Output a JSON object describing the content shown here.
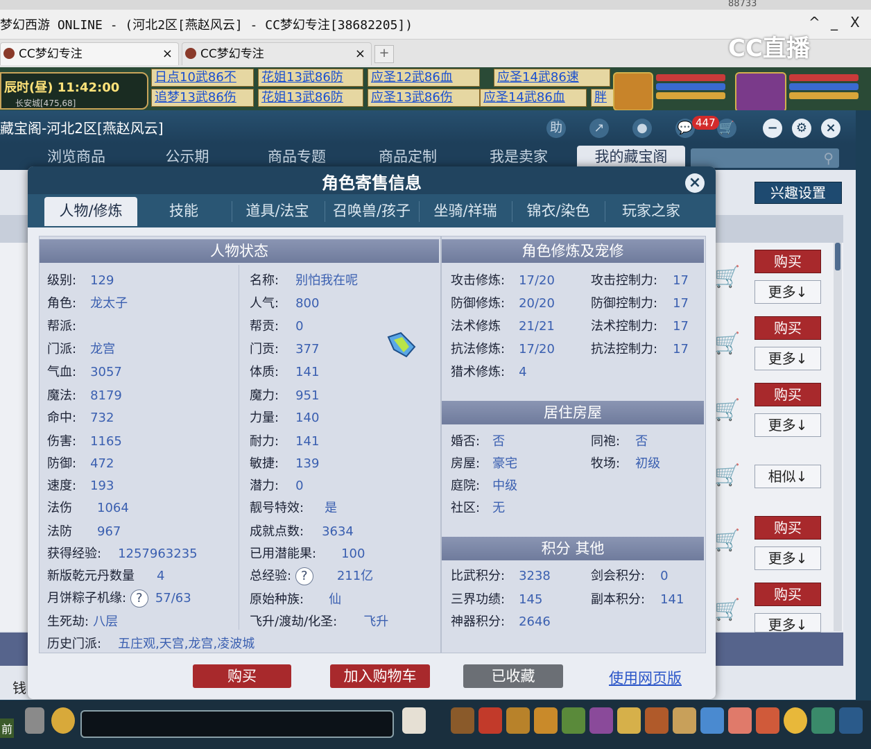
{
  "window": {
    "top_partial": "88733",
    "title": "梦幻西游 ONLINE - (河北2区[燕赵风云] - CC梦幻专注[38682205])",
    "controls": [
      "^",
      "_",
      "X"
    ]
  },
  "browser_tabs": [
    {
      "label": "CC梦幻专注",
      "close": "×"
    },
    {
      "label": "CC梦幻专注",
      "close": "×"
    }
  ],
  "new_tab": "+",
  "stream_logo": "CC直播",
  "game": {
    "time": "辰时(昼) 11:42:00",
    "location": "长安城[475,68]",
    "ads_row1": [
      "日点10武86不",
      "花姐13武86防",
      "应圣12武86血",
      "应圣14武86速"
    ],
    "ads_row2": [
      "追梦13武86伤",
      "花姐13武86防",
      "应圣13武86伤",
      "应圣14武86血",
      "胖"
    ]
  },
  "cbg": {
    "title": "藏宝阁-河北2区[燕赵风云]",
    "header_icons": [
      "助",
      "↗",
      "●",
      "💬",
      "🛒"
    ],
    "cart_count": "447",
    "window_icons": [
      "−",
      "⚙",
      "×"
    ],
    "nav": [
      "浏览商品",
      "公示期",
      "商品专题",
      "商品定制",
      "我是卖家",
      "我的藏宝阁"
    ],
    "interest_button": "兴趣设置",
    "side_buttons": [
      "购买",
      "更多↓",
      "购买",
      "更多↓",
      "购买",
      "更多↓",
      "相似↓",
      "购买",
      "更多↓",
      "购买",
      "更多↓"
    ],
    "money_partial": "钱"
  },
  "dialog": {
    "title": "角色寄售信息",
    "close": "×",
    "tabs": [
      "人物/修炼",
      "技能",
      "道具/法宝",
      "召唤兽/孩子",
      "坐骑/祥瑞",
      "锦衣/染色",
      "玩家之家"
    ],
    "status": {
      "heading": "人物状态",
      "left": [
        {
          "label": "级别:",
          "value": "129"
        },
        {
          "label": "角色:",
          "value": "龙太子"
        },
        {
          "label": "帮派:",
          "value": ""
        },
        {
          "label": "门派:",
          "value": "龙宫"
        },
        {
          "label": "气血:",
          "value": "3057"
        },
        {
          "label": "魔法:",
          "value": "8179"
        },
        {
          "label": "命中:",
          "value": "732"
        },
        {
          "label": "伤害:",
          "value": "1165"
        },
        {
          "label": "防御:",
          "value": "472"
        },
        {
          "label": "速度:",
          "value": "193"
        },
        {
          "label": "法伤",
          "value": "1064"
        },
        {
          "label": "法防",
          "value": "967"
        },
        {
          "label": "获得经验:",
          "value": "1257963235"
        },
        {
          "label": "新版乾元丹数量",
          "value": "4"
        },
        {
          "label": "月饼粽子机缘:",
          "value": "57/63"
        },
        {
          "label": "生死劫:",
          "value": "八层"
        },
        {
          "label": "历史门派:",
          "value": "五庄观,天宫,龙宫,凌波城"
        }
      ],
      "right": [
        {
          "label": "名称:",
          "value": "别怕我在呢"
        },
        {
          "label": "人气:",
          "value": "800"
        },
        {
          "label": "帮贡:",
          "value": "0"
        },
        {
          "label": "门贡:",
          "value": "377"
        },
        {
          "label": "体质:",
          "value": "141"
        },
        {
          "label": "魔力:",
          "value": "951"
        },
        {
          "label": "力量:",
          "value": "140"
        },
        {
          "label": "耐力:",
          "value": "141"
        },
        {
          "label": "敏捷:",
          "value": "139"
        },
        {
          "label": "潜力:",
          "value": "0"
        },
        {
          "label": "靓号特效:",
          "value": "是"
        },
        {
          "label": "成就点数:",
          "value": "3634"
        },
        {
          "label": "已用潜能果:",
          "value": "100"
        },
        {
          "label": "总经验:",
          "value": "211亿"
        },
        {
          "label": "原始种族:",
          "value": "仙"
        },
        {
          "label": "飞升/渡劫/化圣:",
          "value": "飞升"
        }
      ],
      "help": "?"
    },
    "cultivation": {
      "heading": "角色修炼及宠修",
      "left": [
        {
          "label": "攻击修炼:",
          "value": "17/20"
        },
        {
          "label": "防御修炼:",
          "value": "20/20"
        },
        {
          "label": "法术修炼",
          "value": "21/21"
        },
        {
          "label": "抗法修炼:",
          "value": "17/20"
        },
        {
          "label": "猎术修炼:",
          "value": "4"
        }
      ],
      "right": [
        {
          "label": "攻击控制力:",
          "value": "17"
        },
        {
          "label": "防御控制力:",
          "value": "17"
        },
        {
          "label": "法术控制力:",
          "value": "17"
        },
        {
          "label": "抗法控制力:",
          "value": "17"
        }
      ]
    },
    "house": {
      "heading": "居住房屋",
      "rows": [
        {
          "label": "婚否:",
          "value": "否",
          "label2": "同袍:",
          "value2": "否"
        },
        {
          "label": "房屋:",
          "value": "豪宅",
          "label2": "牧场:",
          "value2": "初级"
        },
        {
          "label": "庭院:",
          "value": "中级"
        },
        {
          "label": "社区:",
          "value": "无"
        }
      ]
    },
    "points": {
      "heading": "积分 其他",
      "rows": [
        {
          "label": "比武积分:",
          "value": "3238",
          "label2": "剑会积分:",
          "value2": "0"
        },
        {
          "label": "三界功绩:",
          "value": "145",
          "label2": "副本积分:",
          "value2": "141"
        },
        {
          "label": "神器积分:",
          "value": "2646"
        }
      ]
    },
    "buttons": {
      "buy": "购买",
      "add_cart": "加入购物车",
      "favorited": "已收藏",
      "web": "使用网页版"
    }
  },
  "taskbar": {
    "left_label": "前"
  },
  "colors": {
    "buy_red": "#a8292c",
    "header_navy": "#21445f",
    "value_blue": "#3a5fb0",
    "panel_head": "#7681a2"
  }
}
